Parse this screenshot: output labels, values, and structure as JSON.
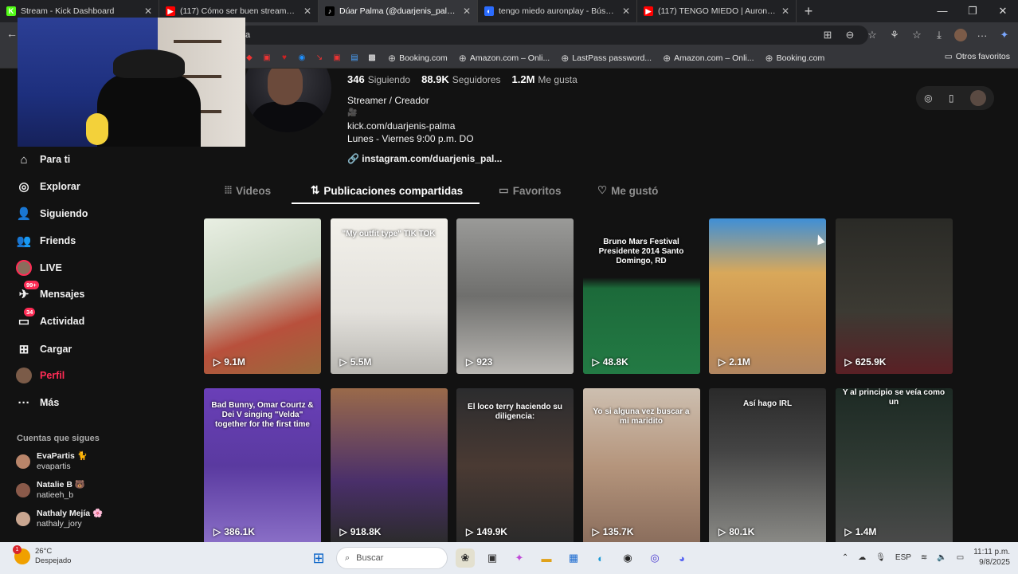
{
  "browser": {
    "tabs": [
      {
        "title": "Stream - Kick Dashboard",
        "favicon": "K",
        "color": "#53fc18",
        "active": false
      },
      {
        "title": "(117) Cómo ser buen streamer en",
        "favicon": "▶",
        "color": "#ff0000",
        "active": false
      },
      {
        "title": "Dúar Palma (@duarjenis_palma) |",
        "favicon": "♪",
        "color": "#000000",
        "active": true
      },
      {
        "title": "tengo miedo auronplay - Búsque",
        "favicon": "◐",
        "color": "#2b6cff",
        "active": false
      },
      {
        "title": "(117) TENGO MIEDO | AuronPlay",
        "favicon": "▶",
        "color": "#ff0000",
        "active": false
      }
    ],
    "new_tab": "+",
    "window_controls": [
      "—",
      "❐",
      "✕"
    ],
    "address": "a",
    "bookmarks": [
      {
        "label": "Booking.com",
        "icon": "globe-icon"
      },
      {
        "label": "Amazon.com – Onli...",
        "icon": "globe-icon"
      },
      {
        "label": "LastPass password...",
        "icon": "globe-icon"
      },
      {
        "label": "Amazon.com – Onli...",
        "icon": "globe-icon"
      },
      {
        "label": "Booking.com",
        "icon": "globe-icon"
      }
    ],
    "other_bookmarks": "Otros favoritos"
  },
  "profile": {
    "following_count": "346",
    "following_label": "Siguiendo",
    "followers_count": "88.9K",
    "followers_label": "Seguidores",
    "likes_count": "1.2M",
    "likes_label": "Me gusta",
    "bio_line1": "Streamer / Creador",
    "bio_line2": "🎥",
    "bio_line3": "kick.com/duarjenis-palma",
    "bio_line4": "Lunes - Viernes 9:00 p.m. DO",
    "link": "instagram.com/duarjenis_pal..."
  },
  "sidebar": {
    "items": [
      {
        "label": "Para ti",
        "icon": "home-icon",
        "glyph": "⌂"
      },
      {
        "label": "Explorar",
        "icon": "compass-icon",
        "glyph": "◎"
      },
      {
        "label": "Siguiendo",
        "icon": "user-plus-icon",
        "glyph": "👤"
      },
      {
        "label": "Friends",
        "icon": "friends-icon",
        "glyph": "👥"
      },
      {
        "label": "LIVE",
        "icon": "live-avatar-icon",
        "glyph": ""
      },
      {
        "label": "Mensajes",
        "icon": "message-icon",
        "glyph": "✈",
        "badge": "99+"
      },
      {
        "label": "Actividad",
        "icon": "inbox-icon",
        "glyph": "▭",
        "badge": "34"
      },
      {
        "label": "Cargar",
        "icon": "upload-icon",
        "glyph": "⊞"
      },
      {
        "label": "Perfil",
        "icon": "profile-avatar-icon",
        "glyph": ""
      },
      {
        "label": "Más",
        "icon": "more-icon",
        "glyph": "···"
      }
    ],
    "section_title": "Cuentas que sigues",
    "following": [
      {
        "name": "EvaPartis 🐈",
        "handle": "evapartis",
        "color": "#b9856a"
      },
      {
        "name": "Natalie B 🐻",
        "handle": "natieeh_b",
        "color": "#8a5a4a"
      },
      {
        "name": "Nathaly Mejía 🌸",
        "handle": "nathaly_jory",
        "color": "#c9a690"
      }
    ]
  },
  "tabs": [
    {
      "label": "Videos",
      "icon": "grid-icon",
      "glyph": "⦙⦙⦙"
    },
    {
      "label": "Publicaciones compartidas",
      "icon": "repost-icon",
      "glyph": "⇅"
    },
    {
      "label": "Favoritos",
      "icon": "bookmark-icon",
      "glyph": "▭"
    },
    {
      "label": "Me gustó",
      "icon": "heart-icon",
      "glyph": "♡"
    }
  ],
  "videos": [
    {
      "views": "9.1M",
      "caption": "",
      "bg": "linear-gradient(160deg,#e9efe3 0%,#c9d6c2 40%,#b8503c 70%,#9a6a3c 100%)"
    },
    {
      "views": "5.5M",
      "caption": "\"My outfit type\" TIK TOK",
      "bg": "linear-gradient(180deg,#f2f0ea 0%,#e3e1dc 60%,#b8b6b1 100%)"
    },
    {
      "views": "923",
      "caption": "",
      "bg": "linear-gradient(180deg,#9a9a98 0%,#6f6f6d 50%,#b9b7b3 100%)"
    },
    {
      "views": "48.8K",
      "caption": "Bruno Mars Festival Presidente 2014 Santo Domingo, RD",
      "bg": "linear-gradient(180deg,#121212 0%,#121212 38%,#1c6a3a 45%,#237a44 100%)"
    },
    {
      "views": "2.1M",
      "caption": "",
      "bg": "linear-gradient(180deg,#3f8fd6 0%,#d9a85a 35%,#c98f4e 70%,#b08560 100%)"
    },
    {
      "views": "625.9K",
      "caption": "",
      "bg": "linear-gradient(180deg,#2a2a26 0%,#3c3a33 60%,#5a2025 100%)"
    },
    {
      "views": "386.1K",
      "caption": "Bad Bunny, Omar Courtz & Dei V singing \"Velda\" together for the first time",
      "bg": "linear-gradient(180deg,#6a3fb8 0%,#5a3aa0 50%,#8a6fc7 100%)"
    },
    {
      "views": "918.8K",
      "caption": "",
      "bg": "linear-gradient(180deg,#9a6a4a 0%,#4a2f6a 60%,#2b2b2b 100%)"
    },
    {
      "views": "149.9K",
      "caption": "El loco terry haciendo su diligencia:",
      "bg": "linear-gradient(180deg,#2b2c2e 0%,#4a3a33 50%,#2a2a2a 100%)"
    },
    {
      "views": "135.7K",
      "caption": "Yo si alguna vez buscar a mi maridito",
      "bg": "linear-gradient(180deg,#cdbfb0 0%,#b5957c 50%,#8a6d5c 100%)"
    },
    {
      "views": "80.1K",
      "caption": "Así hago IRL",
      "bg": "linear-gradient(180deg,#2a2a2a 0%,#444 40%,#8a8a86 100%)"
    },
    {
      "views": "1.4M",
      "caption": "Y al principio se veía como un",
      "bg": "linear-gradient(180deg,#1d2a24 0%,#2f3a33 50%,#4a4a4a 100%)"
    }
  ],
  "taskbar": {
    "temp": "26°C",
    "weather": "Despejado",
    "weather_badge": "1",
    "search_placeholder": "Buscar",
    "lang": "ESP",
    "time": "11:11 p.m.",
    "date": "9/8/2025"
  }
}
